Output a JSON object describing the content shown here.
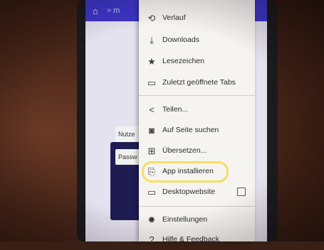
{
  "browser": {
    "url_fragment": "≈ m",
    "top_icon": "home-icon"
  },
  "login": {
    "username_label": "Nutze",
    "password_label": "Passw"
  },
  "menu": {
    "items": [
      {
        "label": "Verlauf",
        "icon": "history-icon"
      },
      {
        "label": "Downloads",
        "icon": "download-icon"
      },
      {
        "label": "Lesezeichen",
        "icon": "star-icon"
      },
      {
        "label": "Zuletzt geöffnete Tabs",
        "icon": "recent-tabs-icon"
      },
      {
        "label": "Teilen...",
        "icon": "share-icon"
      },
      {
        "label": "Auf Seite suchen",
        "icon": "find-in-page-icon"
      },
      {
        "label": "Übersetzen...",
        "icon": "translate-icon"
      },
      {
        "label": "App installieren",
        "icon": "install-app-icon"
      },
      {
        "label": "Desktopwebsite",
        "icon": "desktop-icon"
      },
      {
        "label": "Einstellungen",
        "icon": "settings-icon"
      },
      {
        "label": "Hilfe & Feedback",
        "icon": "help-icon"
      }
    ]
  },
  "colors": {
    "toolbar": "#3e36c8",
    "menu_background": "#f5f4f1",
    "highlight": "#f5dc46"
  }
}
